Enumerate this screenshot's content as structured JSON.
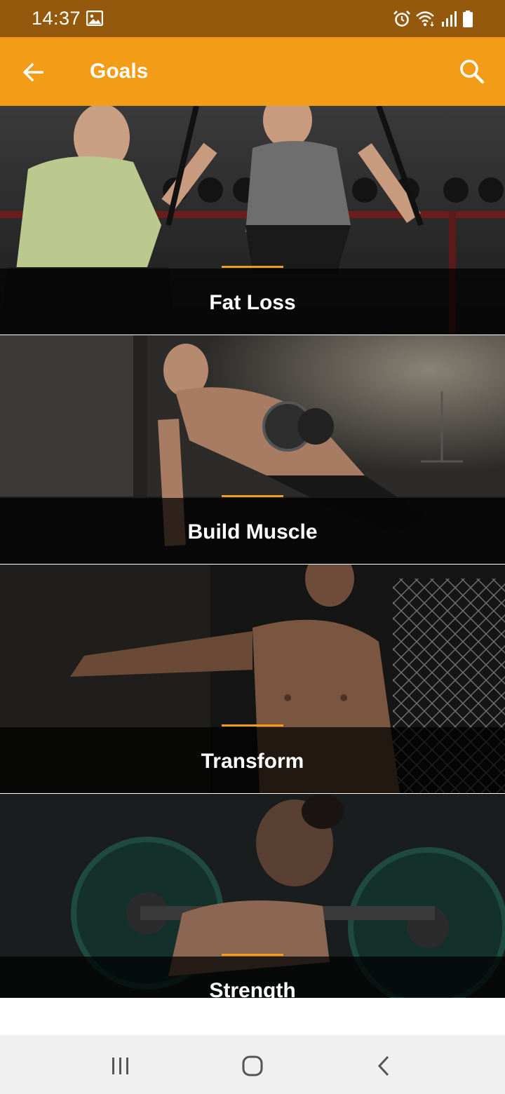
{
  "status_bar": {
    "time": "14:37",
    "icons": [
      "gallery-icon",
      "alarm-icon",
      "wifi-icon",
      "signal-icon",
      "battery-icon"
    ]
  },
  "app_bar": {
    "title": "Goals",
    "back_icon": "arrow-left-icon",
    "search_icon": "search-icon",
    "background": "#f39c17"
  },
  "goals": [
    {
      "label": "Fat Loss"
    },
    {
      "label": "Build Muscle"
    },
    {
      "label": "Transform"
    },
    {
      "label": "Strength"
    }
  ],
  "nav_bar": {
    "icons": [
      "recent-apps-icon",
      "home-icon",
      "back-icon"
    ]
  },
  "colors": {
    "accent": "#f39c17",
    "status_bar": "#94590c",
    "caption_overlay": "#000000"
  }
}
